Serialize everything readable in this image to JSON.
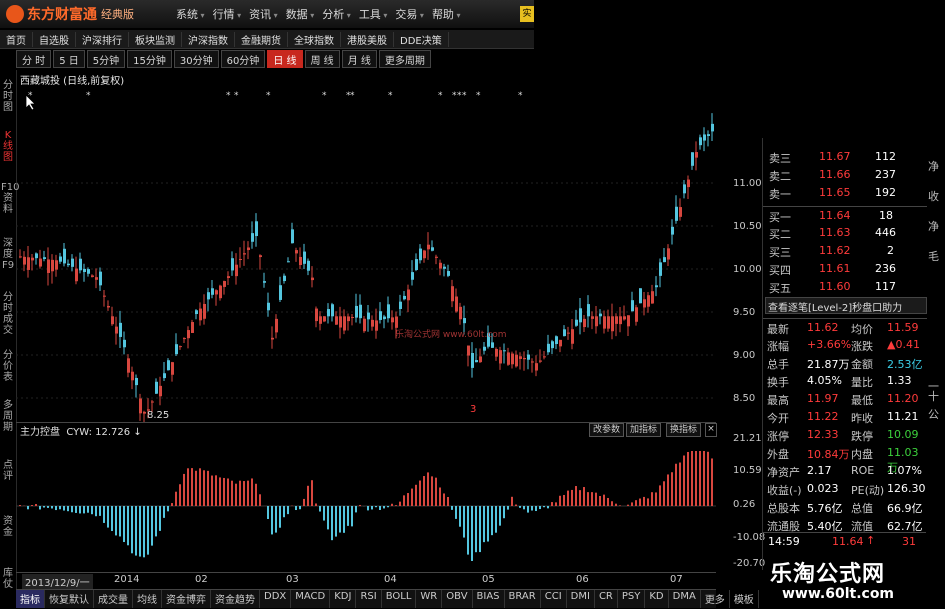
{
  "app": {
    "logo_text": "东方财富通",
    "edition": "经典版",
    "menu": [
      "系统",
      "行情",
      "资讯",
      "数据",
      "分析",
      "工具",
      "交易",
      "帮助"
    ],
    "corner_badge": "实"
  },
  "nav": [
    "首页",
    "自选股",
    "沪深排行",
    "板块监测",
    "沪深指数",
    "金融期货",
    "全球指数",
    "港股美股",
    "DDE决策"
  ],
  "period_tabs": [
    {
      "label": "分 时",
      "active": false
    },
    {
      "label": "5 日",
      "active": false
    },
    {
      "label": "5分钟",
      "active": false
    },
    {
      "label": "15分钟",
      "active": false
    },
    {
      "label": "30分钟",
      "active": false
    },
    {
      "label": "60分钟",
      "active": false
    },
    {
      "label": "日 线",
      "active": true
    },
    {
      "label": "周 线",
      "active": false
    },
    {
      "label": "月 线",
      "active": false
    },
    {
      "label": "更多周期",
      "active": false
    }
  ],
  "left_tabs": [
    {
      "label": "分时图",
      "active": false
    },
    {
      "label": "K线图",
      "active": true
    },
    {
      "label": "F10资料",
      "active": false
    },
    {
      "label": "深度F9",
      "active": false
    },
    {
      "label": "分时成交",
      "active": false
    },
    {
      "label": "分价表",
      "active": false
    },
    {
      "label": "多周期",
      "active": false
    },
    {
      "label": "点评",
      "active": false
    },
    {
      "label": "资金",
      "active": false
    },
    {
      "label": "库仗",
      "active": false
    }
  ],
  "chart_title": "西藏城投 (日线,前复权)",
  "chart_watermark": "乐淘公式网 www.60lt.com",
  "price_axis": [
    "11.00",
    "10.50",
    "10.00",
    "9.50",
    "9.00",
    "8.50"
  ],
  "low_label": "8.25",
  "event_marker": "3",
  "indicator": {
    "name": "主力控盘",
    "value_label": "CYW: 12.726",
    "buttons": [
      "改参数",
      "加指标",
      "换指标"
    ],
    "axis": [
      "21.21",
      "10.59",
      "0.26",
      "-10.08",
      "-20.70"
    ]
  },
  "date_axis": {
    "range_label": "2013/12/9/一",
    "labels": [
      "2014",
      "02",
      "03",
      "04",
      "05",
      "06",
      "07"
    ]
  },
  "bottom_tabs": [
    "指标",
    "恢复默认",
    "成交量",
    "均线",
    "资金博弈",
    "资金趋势",
    "DDX",
    "MACD",
    "KDJ",
    "RSI",
    "BOLL",
    "WR",
    "OBV",
    "BIAS",
    "BRAR",
    "CCI",
    "DMI",
    "CR",
    "PSY",
    "KD",
    "DMA",
    "更多",
    "模板"
  ],
  "quote": {
    "asks": [
      {
        "label": "卖三",
        "price": "11.67",
        "vol": "112"
      },
      {
        "label": "卖二",
        "price": "11.66",
        "vol": "237"
      },
      {
        "label": "卖一",
        "price": "11.65",
        "vol": "192"
      }
    ],
    "bids": [
      {
        "label": "买一",
        "price": "11.64",
        "vol": "18"
      },
      {
        "label": "买二",
        "price": "11.63",
        "vol": "446"
      },
      {
        "label": "买三",
        "price": "11.62",
        "vol": "2"
      },
      {
        "label": "买四",
        "price": "11.61",
        "vol": "236"
      },
      {
        "label": "买五",
        "price": "11.60",
        "vol": "117"
      }
    ],
    "level2_link": "查看逐笔[Level-2]秒盘口助力",
    "stats": [
      {
        "l1": "最新",
        "v1": "11.62",
        "c1": "red",
        "l2": "均价",
        "v2": "11.59",
        "c2": "red"
      },
      {
        "l1": "涨幅",
        "v1": "+3.66%",
        "c1": "red",
        "l2": "涨跌",
        "v2": "▲0.41",
        "c2": "red"
      },
      {
        "l1": "总手",
        "v1": "21.87万",
        "c1": "white",
        "l2": "金额",
        "v2": "2.53亿",
        "c2": "cyan"
      },
      {
        "l1": "换手",
        "v1": "4.05%",
        "c1": "white",
        "l2": "量比",
        "v2": "1.33",
        "c2": "white"
      },
      {
        "l1": "最高",
        "v1": "11.97",
        "c1": "red",
        "l2": "最低",
        "v2": "11.20",
        "c2": "red"
      },
      {
        "l1": "今开",
        "v1": "11.22",
        "c1": "red",
        "l2": "昨收",
        "v2": "11.21",
        "c2": "white"
      },
      {
        "l1": "涨停",
        "v1": "12.33",
        "c1": "red",
        "l2": "跌停",
        "v2": "10.09",
        "c2": "green"
      },
      {
        "l1": "外盘",
        "v1": "10.84万",
        "c1": "red",
        "l2": "内盘",
        "v2": "11.03万",
        "c2": "green"
      },
      {
        "l1": "净资产",
        "v1": "2.17",
        "c1": "white",
        "l2": "ROE",
        "v2": "1.07%",
        "c2": "white"
      },
      {
        "l1": "收益(-)",
        "v1": "0.023",
        "c1": "white",
        "l2": "PE(动)",
        "v2": "126.30",
        "c2": "white"
      },
      {
        "l1": "总股本",
        "v1": "5.76亿",
        "c1": "white",
        "l2": "总值",
        "v2": "66.9亿",
        "c2": "white"
      },
      {
        "l1": "流通股",
        "v1": "5.40亿",
        "c1": "white",
        "l2": "流值",
        "v2": "62.7亿",
        "c2": "white"
      }
    ],
    "tick": {
      "time": "14:59",
      "price": "11.64",
      "vol": "31"
    }
  },
  "edge_chars": [
    "净",
    "收",
    "净",
    "毛",
    "一",
    "十",
    "公"
  ],
  "site_watermark": {
    "title": "乐淘公式网",
    "url": "www.60lt.com"
  },
  "colors": {
    "up": "#d8473f",
    "down": "#54c6df",
    "accent": "#c8281e"
  }
}
